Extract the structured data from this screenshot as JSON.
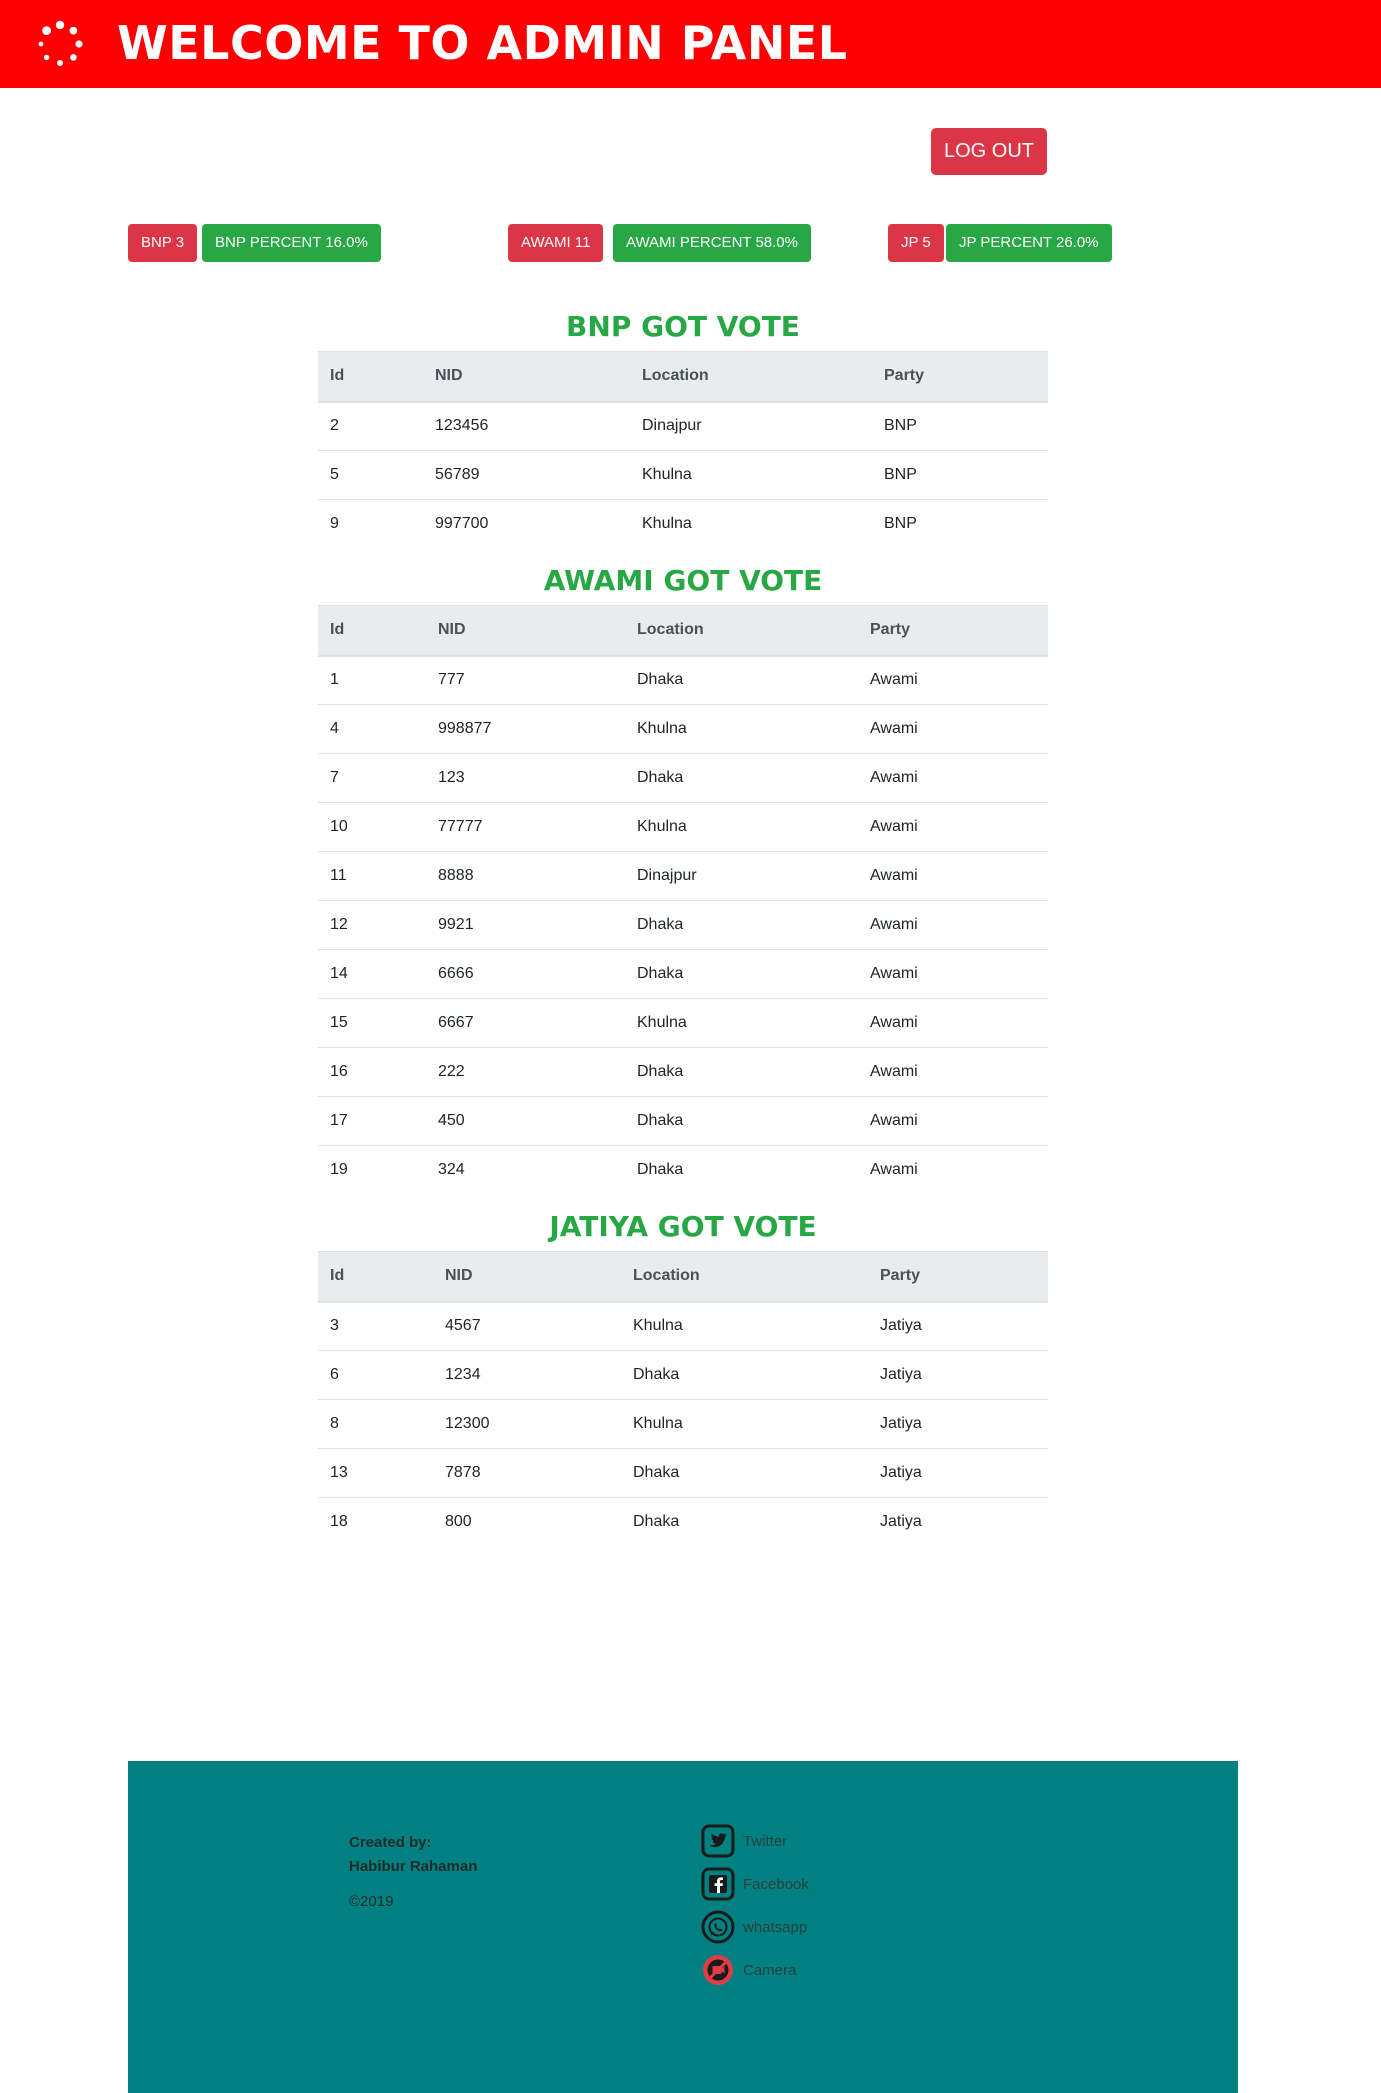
{
  "header": {
    "title": "WELCOME TO ADMIN PANEL",
    "logout_label": "LOG OUT"
  },
  "stats": {
    "bnp_count": "BNP 3",
    "bnp_percent": "BNP PERCENT 16.0%",
    "awami_count": "AWAMI 11",
    "awami_percent": "AWAMI PERCENT 58.0%",
    "jp_count": "JP 5",
    "jp_percent": "JP PERCENT 26.0%"
  },
  "columns": [
    "Id",
    "NID",
    "Location",
    "Party"
  ],
  "bnp": {
    "title": "BNP GOT VOTE",
    "rows": [
      [
        "2",
        "123456",
        "Dinajpur",
        "BNP"
      ],
      [
        "5",
        "56789",
        "Khulna",
        "BNP"
      ],
      [
        "9",
        "997700",
        "Khulna",
        "BNP"
      ]
    ]
  },
  "awami": {
    "title": "AWAMI GOT VOTE",
    "rows": [
      [
        "1",
        "777",
        "Dhaka",
        "Awami"
      ],
      [
        "4",
        "998877",
        "Khulna",
        "Awami"
      ],
      [
        "7",
        "123",
        "Dhaka",
        "Awami"
      ],
      [
        "10",
        "77777",
        "Khulna",
        "Awami"
      ],
      [
        "11",
        "8888",
        "Dinajpur",
        "Awami"
      ],
      [
        "12",
        "9921",
        "Dhaka",
        "Awami"
      ],
      [
        "14",
        "6666",
        "Dhaka",
        "Awami"
      ],
      [
        "15",
        "6667",
        "Khulna",
        "Awami"
      ],
      [
        "16",
        "222",
        "Dhaka",
        "Awami"
      ],
      [
        "17",
        "450",
        "Dhaka",
        "Awami"
      ],
      [
        "19",
        "324",
        "Dhaka",
        "Awami"
      ]
    ]
  },
  "jatiya": {
    "title": "JATIYA GOT VOTE",
    "rows": [
      [
        "3",
        "4567",
        "Khulna",
        "Jatiya"
      ],
      [
        "6",
        "1234",
        "Dhaka",
        "Jatiya"
      ],
      [
        "8",
        "12300",
        "Khulna",
        "Jatiya"
      ],
      [
        "13",
        "7878",
        "Dhaka",
        "Jatiya"
      ],
      [
        "18",
        "800",
        "Dhaka",
        "Jatiya"
      ]
    ]
  },
  "footer": {
    "created_by": "Created by:",
    "author": "Habibur Rahaman",
    "copyright": "©2019",
    "social": {
      "twitter": "Twitter",
      "facebook": "Facebook",
      "whatsapp": "whatsapp",
      "camera": "Camera"
    }
  },
  "colors": {
    "header_bg": "#ff0000",
    "danger": "#dc3545",
    "success": "#28a745",
    "footer_bg": "#008080"
  }
}
